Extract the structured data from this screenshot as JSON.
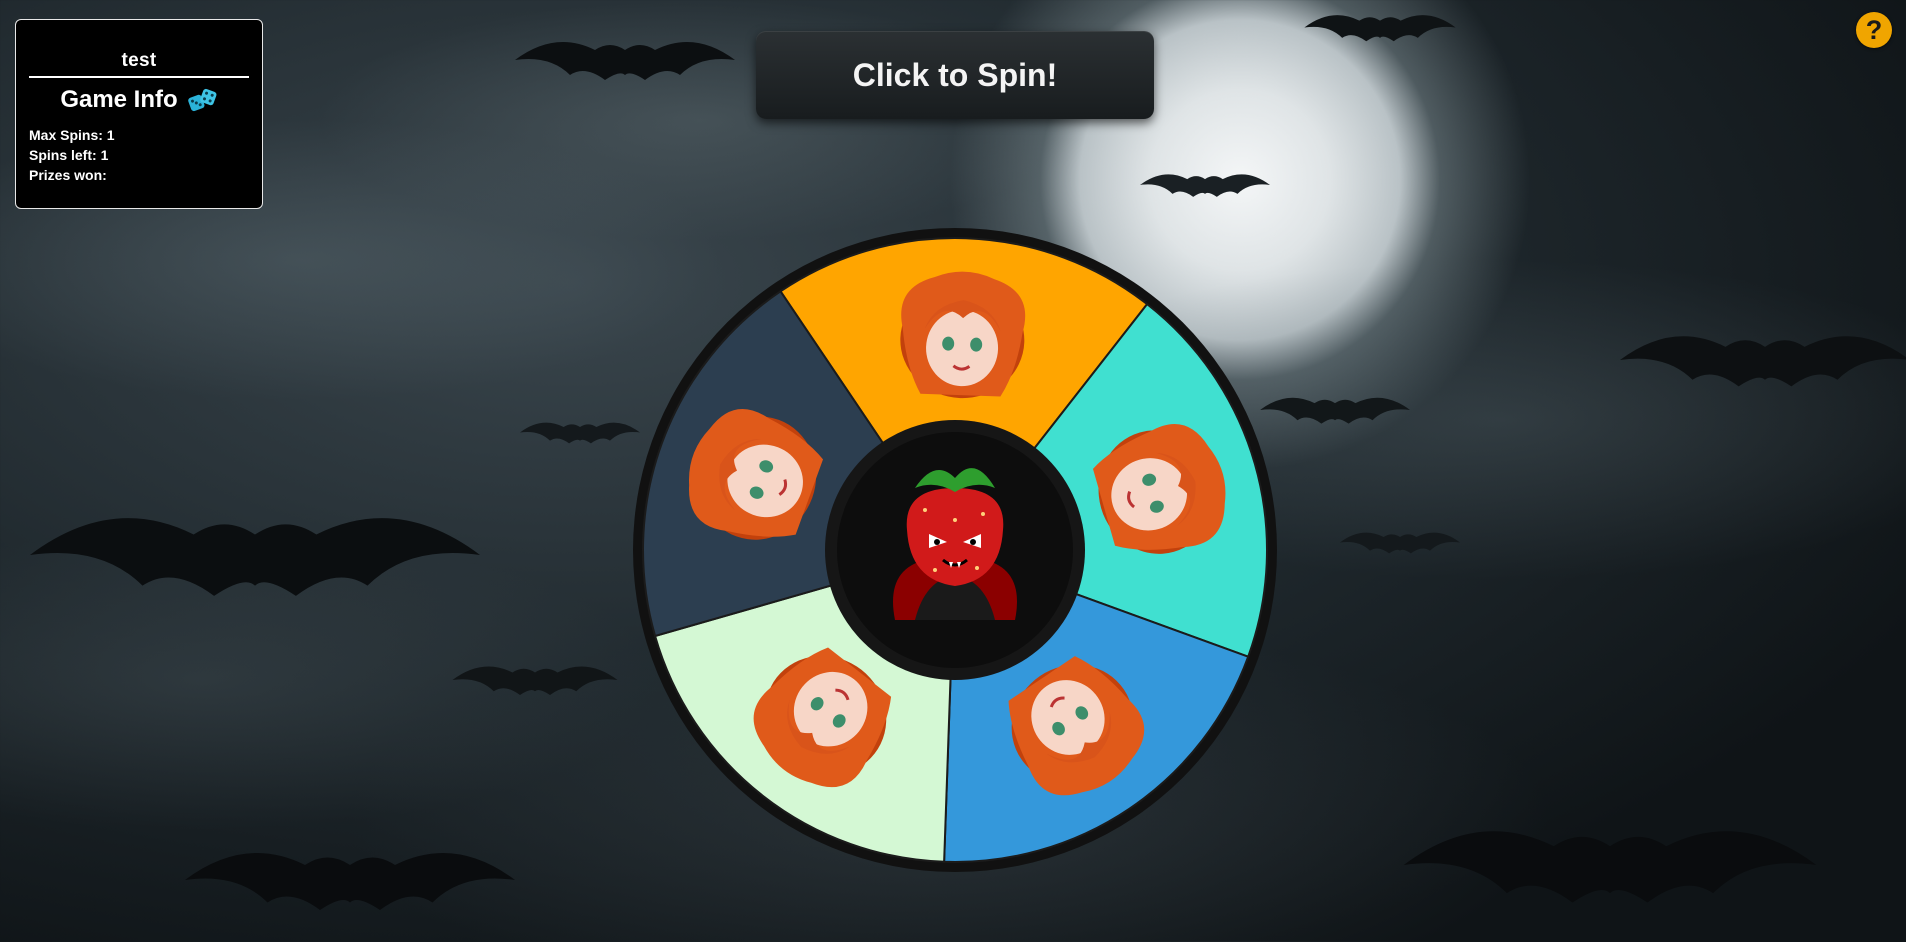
{
  "info": {
    "username": "test",
    "heading": "Game Info",
    "max_spins_label": "Max Spins:",
    "max_spins_value": "1",
    "spins_left_label": "Spins left:",
    "spins_left_value": "1",
    "prizes_won_label": "Prizes won:",
    "prizes_won_value": ""
  },
  "spin_button": {
    "label": "Click to Spin!"
  },
  "help_button": {
    "label": "?"
  },
  "wheel": {
    "segments": [
      {
        "color": "#ffa500",
        "prize_icon": "celebrating-girl-confetti-icon"
      },
      {
        "color": "#40e0d0",
        "prize_icon": "girl-sipping-drink-icon"
      },
      {
        "color": "#3498db",
        "prize_icon": "girl-sleeping-icon"
      },
      {
        "color": "#d4f8d4",
        "prize_icon": "girl-swimming-goggles-icon"
      },
      {
        "color": "#2c3e50",
        "prize_icon": "girl-playing-cards-icon"
      }
    ],
    "center_icon": "vampire-strawberry-icon",
    "rim_color": "#111111"
  },
  "colors": {
    "accent": "#f0a500",
    "panel_bg": "#000000"
  }
}
